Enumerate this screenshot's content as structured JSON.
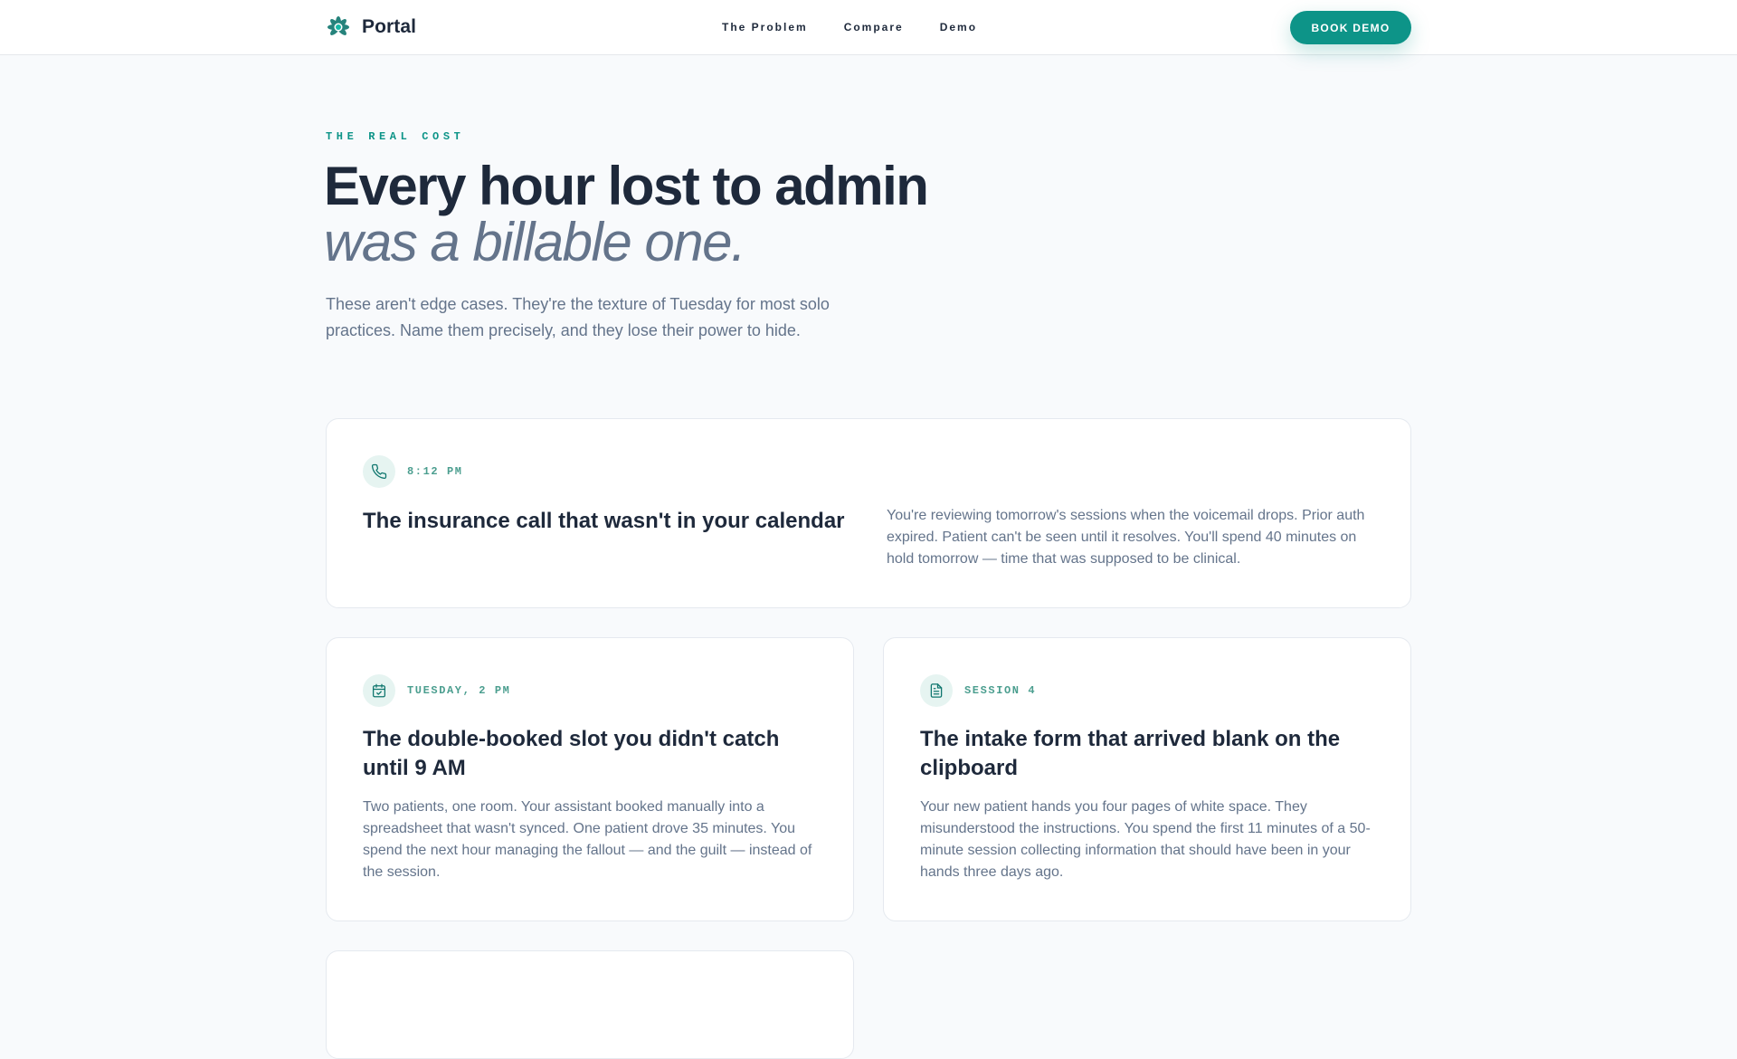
{
  "header": {
    "brand_name": "Portal",
    "brand_icon": "lotus-logo-icon",
    "nav": [
      {
        "label": "The Problem"
      },
      {
        "label": "Compare"
      },
      {
        "label": "Demo"
      }
    ],
    "cta_label": "BOOK DEMO"
  },
  "hero": {
    "eyebrow": "THE REAL COST",
    "headline_line1": "Every hour lost to admin",
    "headline_line2": "was a billable one.",
    "lede": "These aren't edge cases. They're the texture of Tuesday for most solo practices. Name them precisely, and they lose their power to hide."
  },
  "cards": [
    {
      "icon": "phone-icon",
      "time": "8:12 PM",
      "title": "The insurance call that wasn't in your calendar",
      "body": "You're reviewing tomorrow's sessions when the voicemail drops. Prior auth expired. Patient can't be seen until it resolves. You'll spend 40 minutes on hold tomorrow — time that was supposed to be clinical."
    },
    {
      "icon": "calendar-check-icon",
      "time": "TUESDAY, 2 PM",
      "title": "The double-booked slot you didn't catch until 9 AM",
      "body": "Two patients, one room. Your assistant booked manually into a spreadsheet that wasn't synced. One patient drove 35 minutes. You spend the next hour managing the fallout — and the guilt — instead of the session."
    },
    {
      "icon": "document-icon",
      "time": "SESSION 4",
      "title": "The intake form that arrived blank on the clipboard",
      "body": "Your new patient hands you four pages of white space. They misunderstood the instructions. You spend the first 11 minutes of a 50-minute session collecting information that should have been in your hands three days ago."
    }
  ],
  "colors": {
    "accent": "#0d9488",
    "heading": "#1e293b",
    "muted": "#64748b",
    "background": "#f8fafc"
  }
}
